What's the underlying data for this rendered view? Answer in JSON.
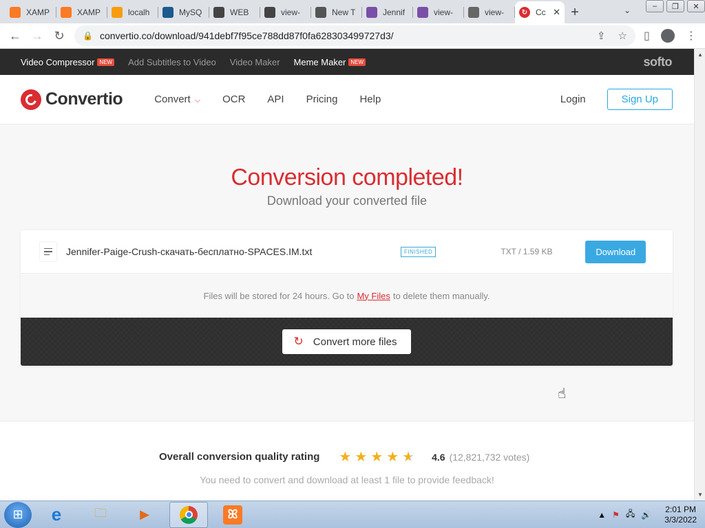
{
  "browser": {
    "tabs": [
      {
        "label": "XAMP",
        "icon": "xampp-diamond-icon",
        "color": "#fb7a24"
      },
      {
        "label": "XAMP",
        "icon": "xampp-icon",
        "color": "#fb7a24"
      },
      {
        "label": "localh",
        "icon": "phpmyadmin-icon",
        "color": "#f89c0e"
      },
      {
        "label": "MySQ",
        "icon": "mysql-icon",
        "color": "#1d5a8e"
      },
      {
        "label": "WEB",
        "icon": "eye-icon",
        "color": "#444444"
      },
      {
        "label": "view-",
        "icon": "eye-icon",
        "color": "#444444"
      },
      {
        "label": "New T",
        "icon": "chrome-icon",
        "color": "#555555"
      },
      {
        "label": "Jennif",
        "icon": "s-icon",
        "color": "#7a4fa8"
      },
      {
        "label": "view-",
        "icon": "s-icon",
        "color": "#7a4fa8"
      },
      {
        "label": "view-",
        "icon": "globe-icon",
        "color": "#666666"
      }
    ],
    "active_tab": {
      "label": "Cc",
      "icon": "convertio-icon",
      "color": "#d92d32"
    },
    "url": "convertio.co/download/941debf7f95ce788dd87f0fa628303499727d3/"
  },
  "topbar": {
    "links": [
      {
        "label": "Video Compressor",
        "is_new": true,
        "dim": false
      },
      {
        "label": "Add Subtitles to Video",
        "is_new": false,
        "dim": true
      },
      {
        "label": "Video Maker",
        "is_new": false,
        "dim": true
      },
      {
        "label": "Meme Maker",
        "is_new": true,
        "dim": false
      }
    ],
    "new_badge": "NEW",
    "brand": "softo"
  },
  "nav": {
    "logo": "Convertio",
    "links": [
      "Convert",
      "OCR",
      "API",
      "Pricing",
      "Help"
    ],
    "login": "Login",
    "signup": "Sign Up"
  },
  "main": {
    "title": "Conversion completed!",
    "subtitle": "Download your converted file",
    "file": {
      "name": "Jennifer-Paige-Crush-скачать-бесплатно-SPACES.IM.txt",
      "status": "FINISHED",
      "size": "TXT / 1.59 KB",
      "download": "Download"
    },
    "storage_note_before": "Files will be stored for 24 hours. Go to",
    "storage_link": "My Files",
    "storage_note_after": "to delete them manually.",
    "convert_more": "Convert more files"
  },
  "rating": {
    "label": "Overall conversion quality rating",
    "score": "4.6",
    "score_value": 4.6,
    "votes": "(12,821,732 votes)",
    "note": "You need to convert and download at least 1 file to provide feedback!"
  },
  "taskbar": {
    "time": "2:01 PM",
    "date": "3/3/2022"
  },
  "colors": {
    "accent": "#d92d32",
    "primary_button": "#3aa9e2"
  }
}
